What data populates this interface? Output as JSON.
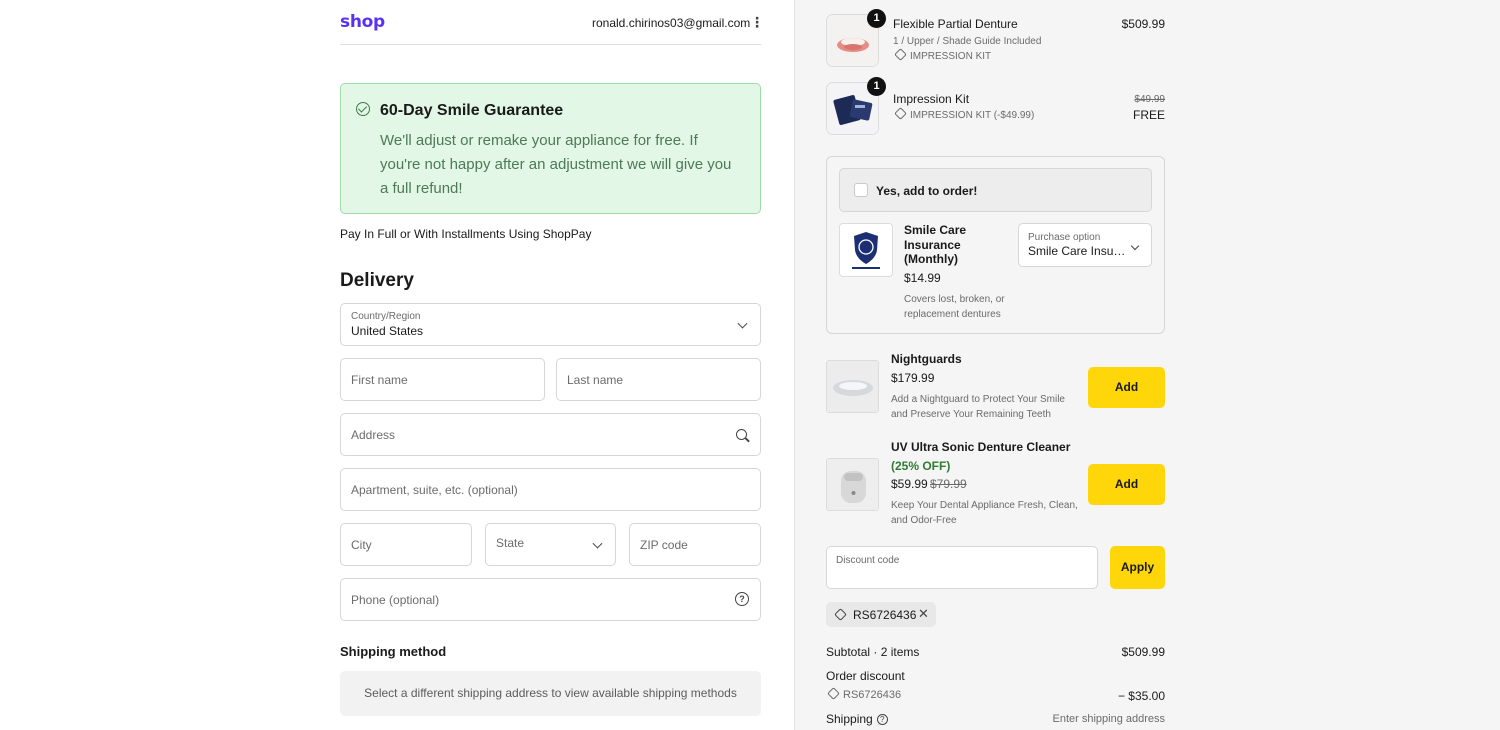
{
  "header": {
    "logo": "shop",
    "email": "ronald.chirinos03@gmail.com",
    "menu_glyph": "⋮"
  },
  "guarantee": {
    "title": "60-Day Smile Guarantee",
    "body": "We'll adjust or remake your appliance for free. If you're not happy after an adjustment we will give you a full refund!"
  },
  "shoppay_note": "Pay In Full or With Installments Using ShopPay",
  "delivery": {
    "heading": "Delivery",
    "country_label": "Country/Region",
    "country_value": "United States",
    "first_name_placeholder": "First name",
    "last_name_placeholder": "Last name",
    "address_placeholder": "Address",
    "apartment_placeholder": "Apartment, suite, etc. (optional)",
    "city_placeholder": "City",
    "state_placeholder": "State",
    "zip_placeholder": "ZIP code",
    "phone_placeholder": "Phone (optional)"
  },
  "shipping": {
    "heading": "Shipping method",
    "message": "Select a different shipping address to view available shipping methods"
  },
  "cart": {
    "items": [
      {
        "name": "Flexible Partial Denture",
        "variant": "1 / Upper / Shade Guide Included",
        "discount_tag": "IMPRESSION KIT",
        "price": "$509.99",
        "quantity": "1"
      },
      {
        "name": "Impression Kit",
        "discount_tag": "IMPRESSION KIT (-$49.99)",
        "original_price": "$49.99",
        "price": "FREE",
        "quantity": "1"
      }
    ]
  },
  "insurance_upsell": {
    "checkbox_label": "Yes, add to order!",
    "name": "Smile Care Insurance (Monthly)",
    "price": "$14.99",
    "description": "Covers lost, broken, or replacement dentures",
    "purchase_option_label": "Purchase option",
    "purchase_option_value": "Smile Care Insurance"
  },
  "upsells": [
    {
      "name": "Nightguards",
      "price": "$179.99",
      "description": "Add a Nightguard to Protect Your Smile and Preserve Your Remaining Teeth",
      "button": "Add"
    },
    {
      "name": "UV Ultra Sonic Denture Cleaner",
      "badge": "(25% OFF)",
      "price": "$59.99",
      "original_price": "$79.99",
      "description": "Keep Your Dental Appliance Fresh, Clean, and Odor-Free",
      "button": "Add"
    }
  ],
  "discount": {
    "label": "Discount code",
    "apply_label": "Apply",
    "applied_code": "RS6726436",
    "remove_glyph": "✕"
  },
  "summary": {
    "subtotal_label": "Subtotal · 2 items",
    "subtotal_value": "$509.99",
    "order_discount_label": "Order discount",
    "order_discount_code": "RS6726436",
    "order_discount_value": "− $35.00",
    "shipping_label": "Shipping",
    "shipping_value": "Enter shipping address"
  },
  "colors": {
    "brand": "#5a31f4",
    "accent_button": "#ffd60a",
    "guarantee_bg": "#e3f7e6",
    "guarantee_border": "#9fdcab",
    "discount_green": "#2e7d32"
  }
}
